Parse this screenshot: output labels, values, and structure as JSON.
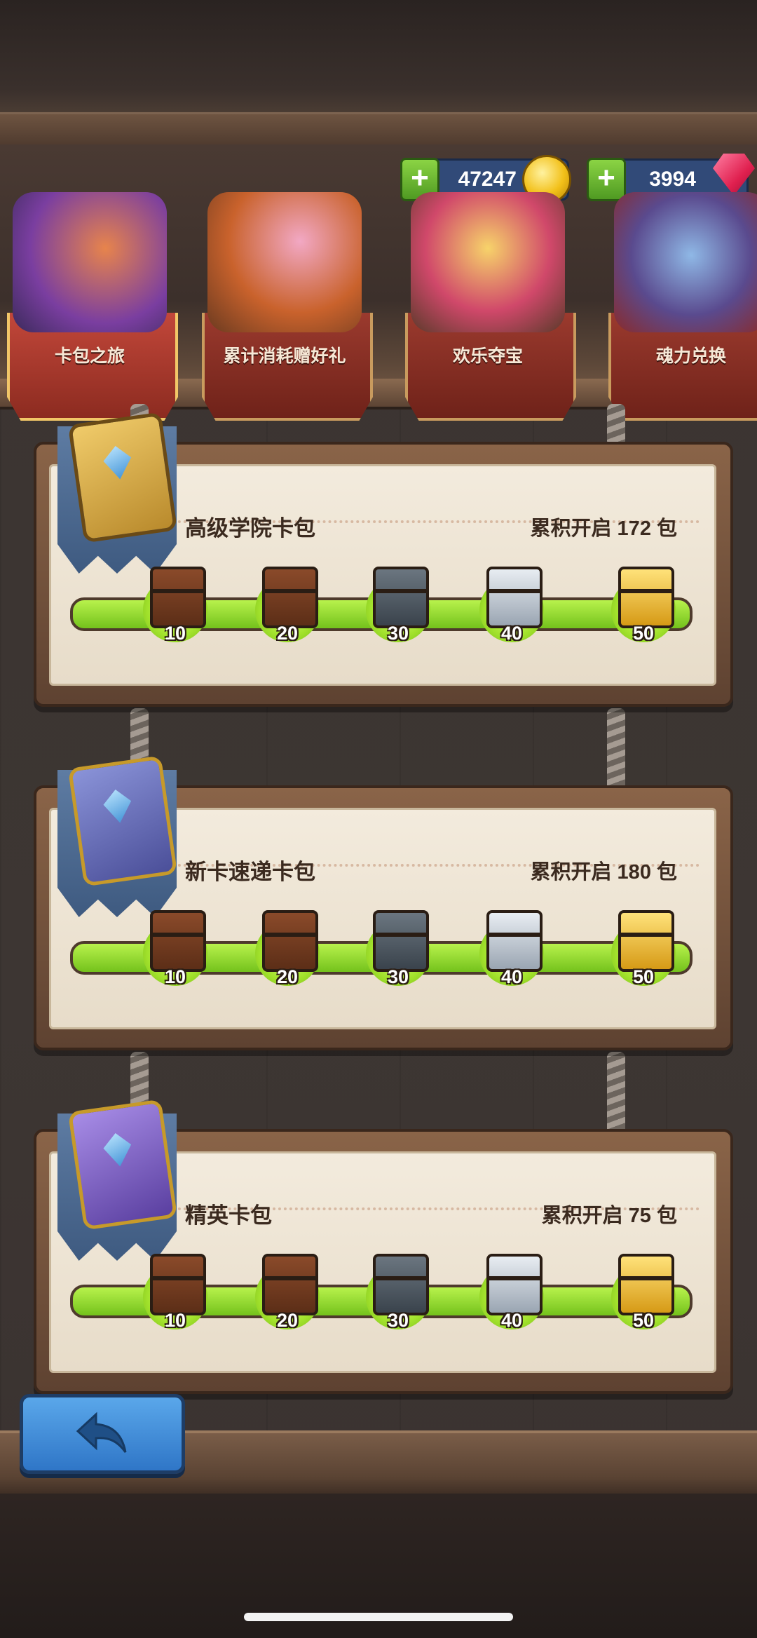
{
  "currencies": [
    {
      "amount": "47247",
      "icon": "gold-coin-icon"
    },
    {
      "amount": "3994",
      "icon": "red-gem-icon"
    }
  ],
  "tabs": [
    {
      "label": "卡包之旅",
      "active": true
    },
    {
      "label": "累计消耗赠好礼",
      "active": false
    },
    {
      "label": "欢乐夺宝",
      "active": false
    },
    {
      "label": "魂力兑换",
      "active": false
    }
  ],
  "packs": [
    {
      "name": "高级学院卡包",
      "opened": "累积开启 172 包",
      "milestones": [
        "10",
        "20",
        "30",
        "40",
        "50"
      ]
    },
    {
      "name": "新卡速递卡包",
      "opened": "累积开启 180 包",
      "milestones": [
        "10",
        "20",
        "30",
        "40",
        "50"
      ]
    },
    {
      "name": "精英卡包",
      "opened": "累积开启 75 包",
      "milestones": [
        "10",
        "20",
        "30",
        "40",
        "50"
      ]
    }
  ],
  "colors": {
    "progress_green": "#8fd832",
    "tab_red": "#9b3a2e",
    "back_button_blue": "#3f8ad8"
  },
  "back_icon": "back-arrow-icon"
}
